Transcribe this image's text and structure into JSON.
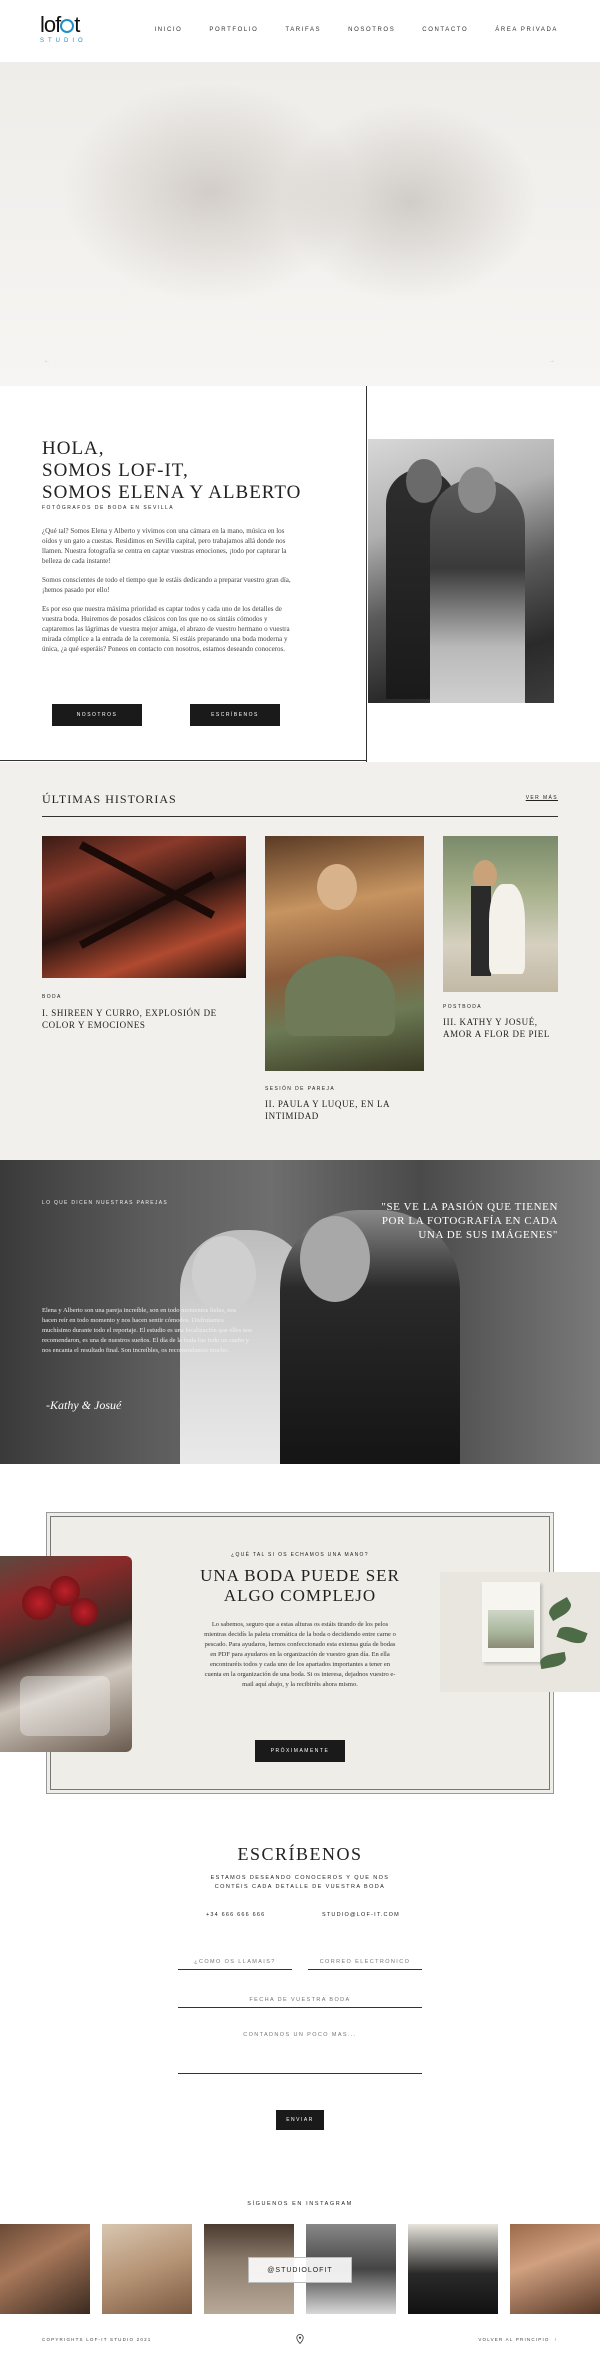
{
  "header": {
    "logo_text_left": "lof",
    "logo_text_right": "t",
    "logo_sub": "STUDIO",
    "nav": [
      {
        "label": "INICIO"
      },
      {
        "label": "PORTFOLIO"
      },
      {
        "label": "TARIFAS"
      },
      {
        "label": "NOSOTROS"
      },
      {
        "label": "CONTACTO"
      },
      {
        "label": "ÁREA PRIVADA"
      }
    ]
  },
  "about": {
    "title_line1": "HOLA,",
    "title_line2": "SOMOS LOF-IT,",
    "title_line3": "SOMOS ELENA Y ALBERTO",
    "subtitle": "FOTÓGRAFOS DE BODA EN SEVILLA",
    "p1": "¿Qué tal? Somos Elena y Alberto y vivimos con una cámara en la mano, música en los oídos y un gato a cuestas. Residimos en Sevilla capital, pero trabajamos allá donde nos llamen. Nuestra fotografía se centra en captar vuestras emociones, ¡todo por capturar la belleza de cada instante!",
    "p2": "Somos conscientes de todo el tiempo que le estáis dedicando a preparar vuestro gran día, ¡hemos pasado por ello!",
    "p3": "Es por eso que nuestra máxima prioridad es captar todos y cada uno de los detalles de vuestra boda. Huiremos de posados clásicos con los que no os sintáis cómodos y captaremos las lágrimas de vuestra mejor amiga, el abrazo de vuestro hermano o vuestra mirada cómplice a la entrada de la ceremonia. Si estáis preparando una boda moderna y única, ¿a qué esperáis? Poneos en contacto con nosotros, estamos deseando conoceros.",
    "btn_nosotros": "NOSOTROS",
    "btn_escribenos": "ESCRÍBENOS"
  },
  "stories": {
    "title": "ÚLTIMAS HISTORIAS",
    "more": "VER MÁS",
    "items": [
      {
        "category": "BODA",
        "title": "I. SHIREEN Y CURRO, EXPLOSIÓN DE COLOR Y EMOCIONES"
      },
      {
        "category": "SESIÓN DE PAREJA",
        "title": "II. PAULA Y LUQUE, EN LA INTIMIDAD"
      },
      {
        "category": "POSTBODA",
        "title": "III. KATHY Y JOSUÉ, AMOR A FLOR DE PIEL"
      }
    ]
  },
  "testimonial": {
    "label": "LO QUE DICEN NUESTRAS PAREJAS",
    "quote": "\"SE VE LA PASIÓN QUE TIENEN POR LA FOTOGRAFÍA EN CADA UNA DE SUS IMÁGENES\"",
    "text": "Elena y Alberto son una pareja increíble, son en todo momentos fieles, nos hacen reír en todo momento y nos hacen sentir cómodos. Disfrutamos muchísimo durante todo el reportaje. El estudio es una localización que elles nos recomendaron, es una de nuestros sueños. El día de la boda fue todo un sueño y nos encanta el resultado final. Son increíbles, os recomendamos mucho.",
    "sign": "-Kathy & Josué"
  },
  "guide": {
    "lead": "¿QUÉ TAL SI OS ECHAMOS UNA MANO?",
    "title_line1": "UNA BODA PUEDE SER",
    "title_line2": "ALGO COMPLEJO",
    "desc": "Lo sabemos, seguro que a estas alturas os estáis tirando de los pelos mientras decidís la paleta cromática de la boda o decidiendo entre carne o pescado. Para ayudaros, hemos confeccionado esta extensa guía de bodas en PDF para ayudaros en la organización de vuestro gran día. En ella encontraréis todos y cada uno de los apartados importantes a tener en cuenta en la organización de una boda. Si os interesa, dejadnos vuestro e-mail aquí abajo, y la recibiréis ahora mismo.",
    "button": "PRÓXIMAMENTE"
  },
  "contact": {
    "title": "ESCRÍBENOS",
    "intro_line1": "ESTAMOS DESEANDO CONOCEROS Y QUE NOS",
    "intro_line2": "CONTÉIS CADA DETALLE DE VUESTRA BODA",
    "phone": "+34 666 666 666",
    "email": "STUDIO@LOF-IT.COM",
    "name_placeholder": "¿CÓMO OS LLAMÁIS?",
    "email_placeholder": "CORREO ELECTRÓNICO",
    "date_placeholder": "FECHA DE VUESTRA BODA",
    "message_placeholder": "CONTADNOS UN POCO MÁS...",
    "submit": "ENVIAR"
  },
  "instagram": {
    "title": "SÍGUENOS EN INSTAGRAM",
    "handle": "@STUDIOLOFIT"
  },
  "footer": {
    "copyright": "COPYRIGHTS LOF-IT STUDIO 2021",
    "back_to_top": "VOLVER AL PRINCIPIO"
  },
  "colors": {
    "accent": "#1e90c9",
    "dark": "#1a1a1a",
    "section_bg": "#f1f0ec"
  }
}
